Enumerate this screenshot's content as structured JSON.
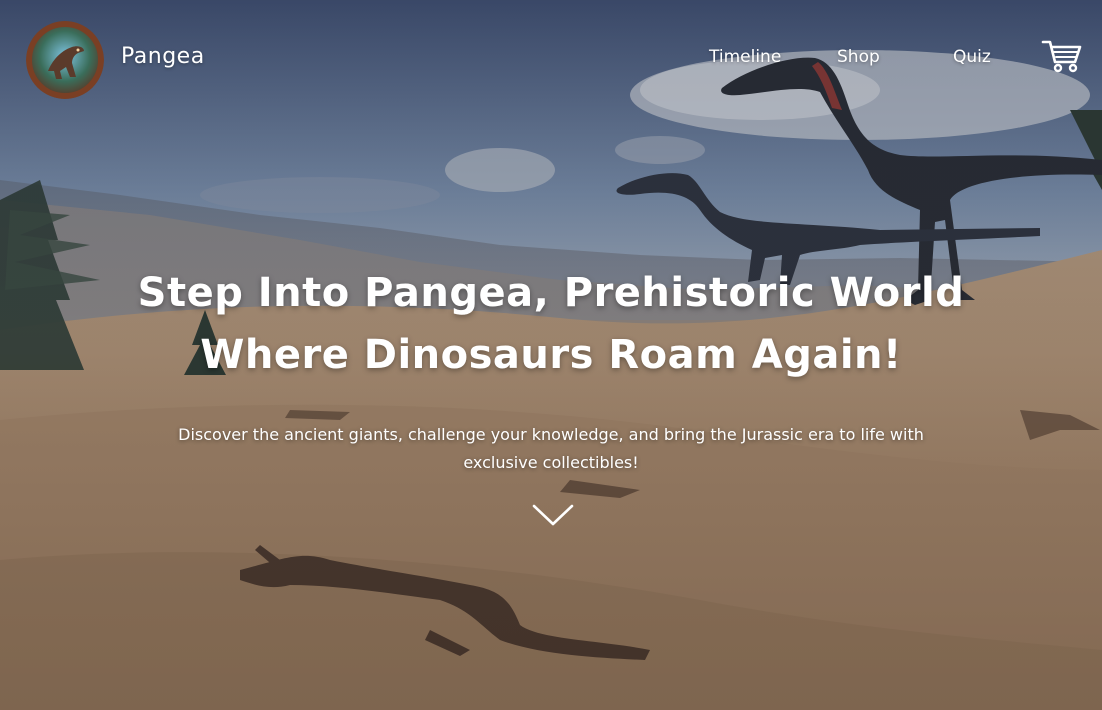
{
  "nav": {
    "brand": "Pangea",
    "links": [
      {
        "label": "Timeline"
      },
      {
        "label": "Shop"
      },
      {
        "label": "Quiz"
      }
    ],
    "cart_icon": "shopping-cart-icon",
    "logo_icon": "t-rex-logo"
  },
  "hero": {
    "headline_line1": "Step Into Pangea, Prehistoric World",
    "headline_line2": "Where Dinosaurs Roam Again!",
    "subtitle_line1": "Discover the ancient giants, challenge your knowledge, and bring the Jurassic era to life with",
    "subtitle_line2": "exclusive collectibles!",
    "scroll_icon": "chevron-down-icon"
  },
  "colors": {
    "text": "#ffffff",
    "sky": "#4a5a7a",
    "sand": "#a88a6f"
  }
}
